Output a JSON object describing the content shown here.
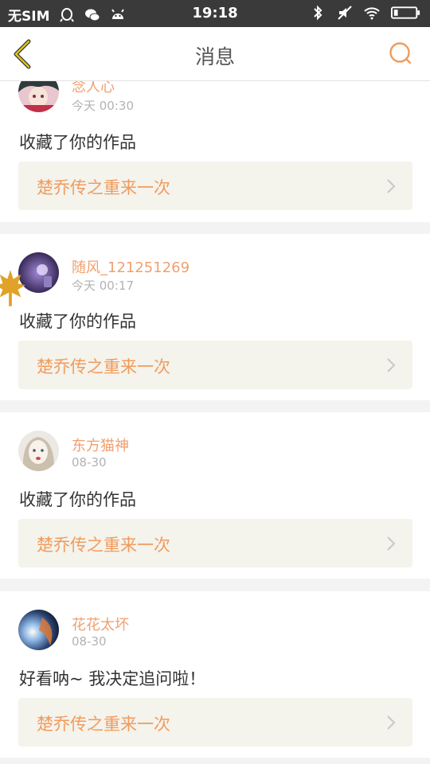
{
  "status_bar": {
    "carrier": "无SIM",
    "time": "19:18",
    "icons_left": [
      "qq-icon",
      "wechat-icon",
      "android-icon"
    ],
    "icons_right": [
      "bluetooth-icon",
      "mute-icon",
      "wifi-icon",
      "battery-icon"
    ]
  },
  "header": {
    "title": "消息",
    "back_icon": "chevron-left-icon",
    "search_icon": "search-icon"
  },
  "colors": {
    "accent": "#f19b5c",
    "username": "#f0a070",
    "link_bg": "#f4f3ec",
    "status_bar": "#3a3a3a"
  },
  "messages": [
    {
      "username": "念人心",
      "time": "今天 00:30",
      "message": "收藏了你的作品",
      "work_title": "楚乔传之重来一次"
    },
    {
      "username": "随风_121251269",
      "time": "今天 00:17",
      "message": "收藏了你的作品",
      "work_title": "楚乔传之重来一次"
    },
    {
      "username": "东方猫神",
      "time": "08-30",
      "message": "收藏了你的作品",
      "work_title": "楚乔传之重来一次"
    },
    {
      "username": "花花太坏",
      "time": "08-30",
      "message": "好看呐~ 我决定追问啦！",
      "work_title": "楚乔传之重来一次"
    }
  ]
}
